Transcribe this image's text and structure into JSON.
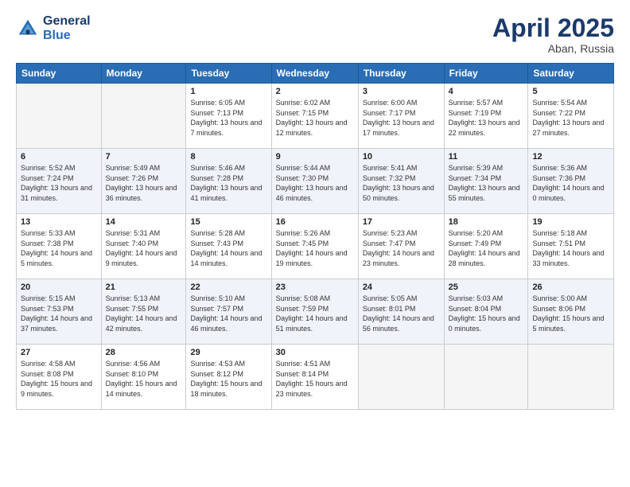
{
  "header": {
    "logo_line1": "General",
    "logo_line2": "Blue",
    "month_title": "April 2025",
    "location": "Aban, Russia"
  },
  "weekdays": [
    "Sunday",
    "Monday",
    "Tuesday",
    "Wednesday",
    "Thursday",
    "Friday",
    "Saturday"
  ],
  "weeks": [
    [
      {
        "day": "",
        "empty": true
      },
      {
        "day": "",
        "empty": true
      },
      {
        "day": "1",
        "sunrise": "6:05 AM",
        "sunset": "7:13 PM",
        "daylight": "13 hours and 7 minutes."
      },
      {
        "day": "2",
        "sunrise": "6:02 AM",
        "sunset": "7:15 PM",
        "daylight": "13 hours and 12 minutes."
      },
      {
        "day": "3",
        "sunrise": "6:00 AM",
        "sunset": "7:17 PM",
        "daylight": "13 hours and 17 minutes."
      },
      {
        "day": "4",
        "sunrise": "5:57 AM",
        "sunset": "7:19 PM",
        "daylight": "13 hours and 22 minutes."
      },
      {
        "day": "5",
        "sunrise": "5:54 AM",
        "sunset": "7:22 PM",
        "daylight": "13 hours and 27 minutes."
      }
    ],
    [
      {
        "day": "6",
        "sunrise": "5:52 AM",
        "sunset": "7:24 PM",
        "daylight": "13 hours and 31 minutes."
      },
      {
        "day": "7",
        "sunrise": "5:49 AM",
        "sunset": "7:26 PM",
        "daylight": "13 hours and 36 minutes."
      },
      {
        "day": "8",
        "sunrise": "5:46 AM",
        "sunset": "7:28 PM",
        "daylight": "13 hours and 41 minutes."
      },
      {
        "day": "9",
        "sunrise": "5:44 AM",
        "sunset": "7:30 PM",
        "daylight": "13 hours and 46 minutes."
      },
      {
        "day": "10",
        "sunrise": "5:41 AM",
        "sunset": "7:32 PM",
        "daylight": "13 hours and 50 minutes."
      },
      {
        "day": "11",
        "sunrise": "5:39 AM",
        "sunset": "7:34 PM",
        "daylight": "13 hours and 55 minutes."
      },
      {
        "day": "12",
        "sunrise": "5:36 AM",
        "sunset": "7:36 PM",
        "daylight": "14 hours and 0 minutes."
      }
    ],
    [
      {
        "day": "13",
        "sunrise": "5:33 AM",
        "sunset": "7:38 PM",
        "daylight": "14 hours and 5 minutes."
      },
      {
        "day": "14",
        "sunrise": "5:31 AM",
        "sunset": "7:40 PM",
        "daylight": "14 hours and 9 minutes."
      },
      {
        "day": "15",
        "sunrise": "5:28 AM",
        "sunset": "7:43 PM",
        "daylight": "14 hours and 14 minutes."
      },
      {
        "day": "16",
        "sunrise": "5:26 AM",
        "sunset": "7:45 PM",
        "daylight": "14 hours and 19 minutes."
      },
      {
        "day": "17",
        "sunrise": "5:23 AM",
        "sunset": "7:47 PM",
        "daylight": "14 hours and 23 minutes."
      },
      {
        "day": "18",
        "sunrise": "5:20 AM",
        "sunset": "7:49 PM",
        "daylight": "14 hours and 28 minutes."
      },
      {
        "day": "19",
        "sunrise": "5:18 AM",
        "sunset": "7:51 PM",
        "daylight": "14 hours and 33 minutes."
      }
    ],
    [
      {
        "day": "20",
        "sunrise": "5:15 AM",
        "sunset": "7:53 PM",
        "daylight": "14 hours and 37 minutes."
      },
      {
        "day": "21",
        "sunrise": "5:13 AM",
        "sunset": "7:55 PM",
        "daylight": "14 hours and 42 minutes."
      },
      {
        "day": "22",
        "sunrise": "5:10 AM",
        "sunset": "7:57 PM",
        "daylight": "14 hours and 46 minutes."
      },
      {
        "day": "23",
        "sunrise": "5:08 AM",
        "sunset": "7:59 PM",
        "daylight": "14 hours and 51 minutes."
      },
      {
        "day": "24",
        "sunrise": "5:05 AM",
        "sunset": "8:01 PM",
        "daylight": "14 hours and 56 minutes."
      },
      {
        "day": "25",
        "sunrise": "5:03 AM",
        "sunset": "8:04 PM",
        "daylight": "15 hours and 0 minutes."
      },
      {
        "day": "26",
        "sunrise": "5:00 AM",
        "sunset": "8:06 PM",
        "daylight": "15 hours and 5 minutes."
      }
    ],
    [
      {
        "day": "27",
        "sunrise": "4:58 AM",
        "sunset": "8:08 PM",
        "daylight": "15 hours and 9 minutes."
      },
      {
        "day": "28",
        "sunrise": "4:56 AM",
        "sunset": "8:10 PM",
        "daylight": "15 hours and 14 minutes."
      },
      {
        "day": "29",
        "sunrise": "4:53 AM",
        "sunset": "8:12 PM",
        "daylight": "15 hours and 18 minutes."
      },
      {
        "day": "30",
        "sunrise": "4:51 AM",
        "sunset": "8:14 PM",
        "daylight": "15 hours and 23 minutes."
      },
      {
        "day": "",
        "empty": true
      },
      {
        "day": "",
        "empty": true
      },
      {
        "day": "",
        "empty": true
      }
    ]
  ]
}
